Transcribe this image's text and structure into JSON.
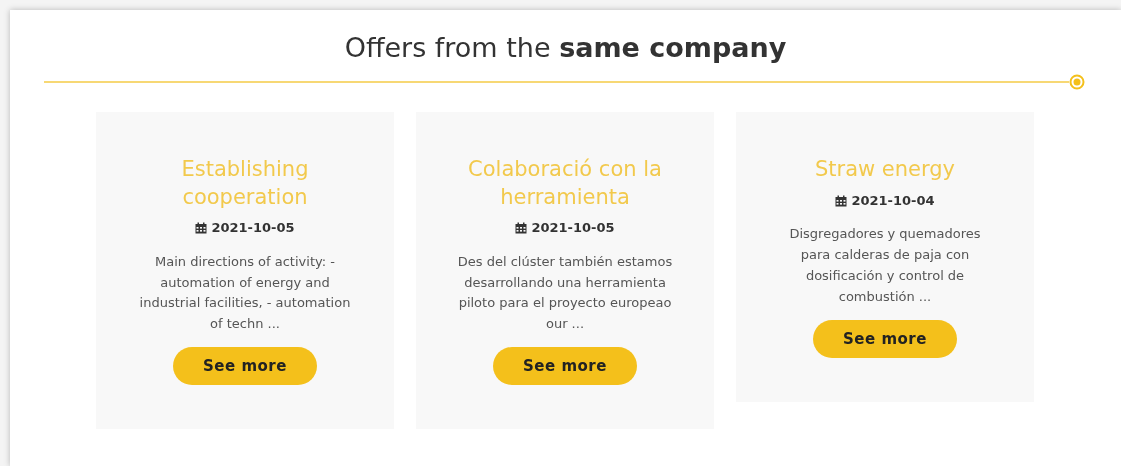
{
  "heading": "Offers from the **same company**",
  "offers": [
    {
      "title": "Establishing cooperation",
      "date": "2021-10-05",
      "description": "Main directions of activity: - automation of energy and industrial facilities, - automation of techn ...",
      "button": "See more"
    },
    {
      "title": "Colaboració con la herramienta",
      "date": "2021-10-05",
      "description": "Des del clúster también estamos desarrollando una herramienta piloto para el proyecto europeao our ...",
      "button": "See more"
    },
    {
      "title": "Straw energy",
      "date": "2021-10-04",
      "description": "Disgregadores y quemadores para calderas de paja con dosificación y control de combustión ...",
      "button": "See more"
    }
  ]
}
